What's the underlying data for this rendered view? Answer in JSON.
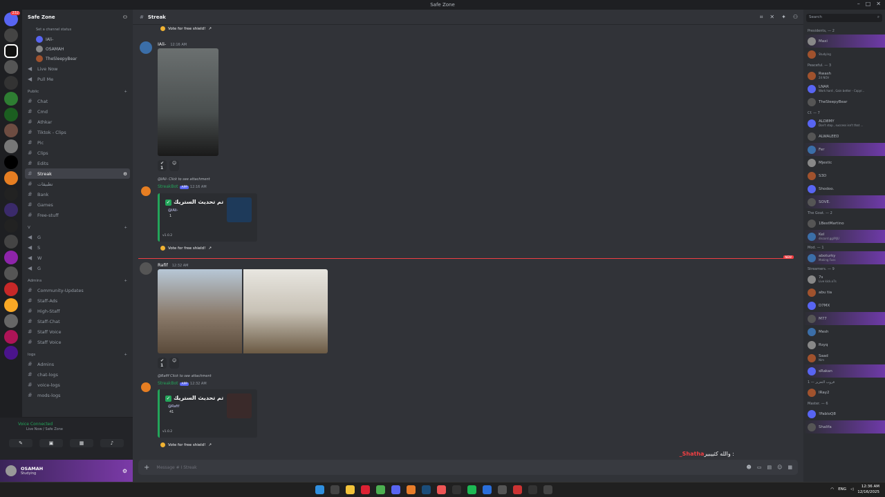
{
  "window": {
    "title": "Safe Zone"
  },
  "rail": {
    "badge": "232"
  },
  "server": {
    "name": "Safe Zone",
    "top_voice_users": [
      {
        "name": "Set a channel status"
      },
      {
        "name": "IAli-"
      },
      {
        "name": "OSAMAH"
      },
      {
        "name": "TheSleepyBear"
      }
    ],
    "top_channels": [
      {
        "label": "Live Now",
        "icon": "speaker-icon"
      },
      {
        "label": "Pull Me",
        "icon": "speaker-icon"
      }
    ],
    "categories": [
      {
        "label": "Public",
        "channels": [
          "Chat",
          "Cmd",
          "Athkar",
          "Tiktok - Clips",
          "Pic",
          "Clips",
          "Edits",
          "Streak",
          "تطبيقات",
          "Bank",
          "Games",
          "Free-stuff"
        ]
      },
      {
        "label": "V",
        "channels": [
          "G",
          "S",
          "W",
          "G"
        ]
      },
      {
        "label": "Admins",
        "channels": [
          "Community-Updates",
          "Staff-Ads",
          "High-Staff",
          "Staff-Chat",
          "Staff Voice",
          "Staff Voice"
        ]
      },
      {
        "label": "logs",
        "channels": [
          "Admins",
          "chat-logs",
          "voice-logs",
          "mods-logs"
        ]
      }
    ],
    "active_channel": "Streak"
  },
  "voice": {
    "status": "Voice Connected",
    "location": "Live Now / Safe Zone"
  },
  "user": {
    "name": "OSAMAH",
    "status": "Studying"
  },
  "channel": {
    "name": "Streak",
    "composer_placeholder": "Message # I Streak"
  },
  "messages": {
    "vote_label": "Vote for free shield!",
    "m1": {
      "author": "IAli-",
      "time": "12:16 AM",
      "reaction": "1"
    },
    "m2": {
      "reply": "@IAli- Click to see attachment",
      "bot": "StreakBot",
      "app": "APP",
      "time": "12:16 AM",
      "title": "تم تحديث الستريك",
      "mention": "@IAli-",
      "count": "1",
      "version": "v1.0.2"
    },
    "m3": {
      "author": "Rafif",
      "time": "12:32 AM",
      "reaction": "1"
    },
    "m4": {
      "reply": "@Rafif Click to see attachment",
      "bot": "StreakBot",
      "app": "APP",
      "time": "12:32 AM",
      "title": "تم تحديث الستريك",
      "mention": "@Rafif",
      "count": "41",
      "version": "v1.0.2"
    },
    "new_tag": "NEW",
    "typing_text": "والله كثييبير : ",
    "typing_name": "_Shatha"
  },
  "members": {
    "search_placeholder": "Search",
    "groups": [
      {
        "label": "Presidents, — 2",
        "members": [
          {
            "name": "Maxi",
            "sub": ""
          },
          {
            "name": "",
            "sub": "Studying"
          }
        ]
      },
      {
        "label": "Peaceful. — 3",
        "members": [
          {
            "name": "Rwash",
            "sub": "24 NOV"
          },
          {
            "name": "LNAR",
            "sub": "Work hard , Gain better - Copyr..."
          },
          {
            "name": "TheSleepyBear",
            "sub": ""
          }
        ]
      },
      {
        "label": "Cf. — 7",
        "members": [
          {
            "name": "ALD8MY",
            "sub": "Don't stop , success isn't that ..."
          },
          {
            "name": "ALWALEED",
            "sub": ""
          },
          {
            "name": "Fer",
            "sub": ""
          },
          {
            "name": "Mjestic",
            "sub": ""
          },
          {
            "name": "S3D",
            "sub": ""
          },
          {
            "name": "Shodoo.",
            "sub": ""
          },
          {
            "name": "SOVE.",
            "sub": ""
          }
        ]
      },
      {
        "label": "The Goat. — 2",
        "members": [
          {
            "name": "1BestMartino",
            "sub": ""
          },
          {
            "name": "Kel",
            "sub": "discord.gg/MJU"
          }
        ]
      },
      {
        "label": "Mod. — 1",
        "members": [
          {
            "name": "aboturky",
            "sub": "Making Fuss"
          }
        ]
      },
      {
        "label": "Streamers. — 9",
        "members": [
          {
            "name": "7s",
            "sub": "Live kick.o7s"
          },
          {
            "name": "abu tia",
            "sub": ""
          },
          {
            "name": "D7MX",
            "sub": ""
          },
          {
            "name": "M77",
            "sub": ""
          },
          {
            "name": "Mesh",
            "sub": ""
          },
          {
            "name": "Rsyq",
            "sub": ""
          },
          {
            "name": "Saad",
            "sub": "Nim"
          },
          {
            "name": "sRakan",
            "sub": ""
          }
        ]
      },
      {
        "label": "قروب التعزيز — 1",
        "members": [
          {
            "name": "IRay2",
            "sub": ""
          }
        ]
      },
      {
        "label": "Master. — 6",
        "members": [
          {
            "name": "!PabloQ8",
            "sub": ""
          },
          {
            "name": "Shalifa",
            "sub": ""
          }
        ]
      }
    ]
  },
  "taskbar": {
    "lang": "ENG",
    "time": "12:36 AM",
    "date": "12/16/2025"
  },
  "colors": {
    "accent": "#5865f2",
    "green": "#23a55a",
    "red": "#f23f43"
  }
}
